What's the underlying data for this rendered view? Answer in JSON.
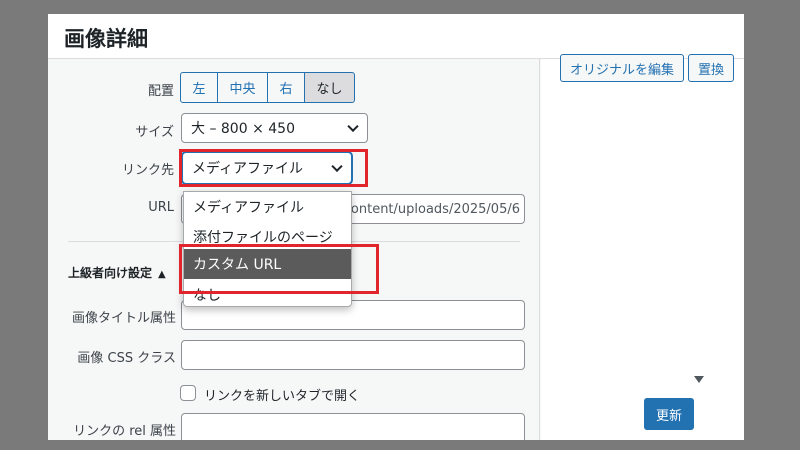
{
  "modal": {
    "title": "画像詳細"
  },
  "alignment": {
    "label": "配置",
    "options": [
      "左",
      "中央",
      "右",
      "なし"
    ],
    "selected": "なし"
  },
  "size": {
    "label": "サイズ",
    "value": "大 – 800 × 450"
  },
  "link": {
    "label": "リンク先",
    "value": "メディアファイル",
    "options": [
      "メディアファイル",
      "添付ファイルのページ",
      "カスタム URL",
      "なし"
    ],
    "highlighted": "カスタム URL"
  },
  "url": {
    "label": "URL",
    "value": "p-content/uploads/2025/05/6"
  },
  "advanced": {
    "label": "上級者向け設定",
    "toggle_icon": "▲"
  },
  "image_title_attr": {
    "label": "画像タイトル属性",
    "value": ""
  },
  "image_css_class": {
    "label": "画像 CSS クラス",
    "value": ""
  },
  "open_new_tab": {
    "label": "リンクを新しいタブで開く",
    "checked": false
  },
  "link_rel": {
    "label": "リンクの rel 属性"
  },
  "aside": {
    "edit_original": "オリジナルを編集",
    "replace": "置換"
  },
  "footer": {
    "update": "更新"
  },
  "colors": {
    "accent": "#2271b1",
    "highlight_border": "#e0262c",
    "selected_option": "#5b5b5b"
  }
}
